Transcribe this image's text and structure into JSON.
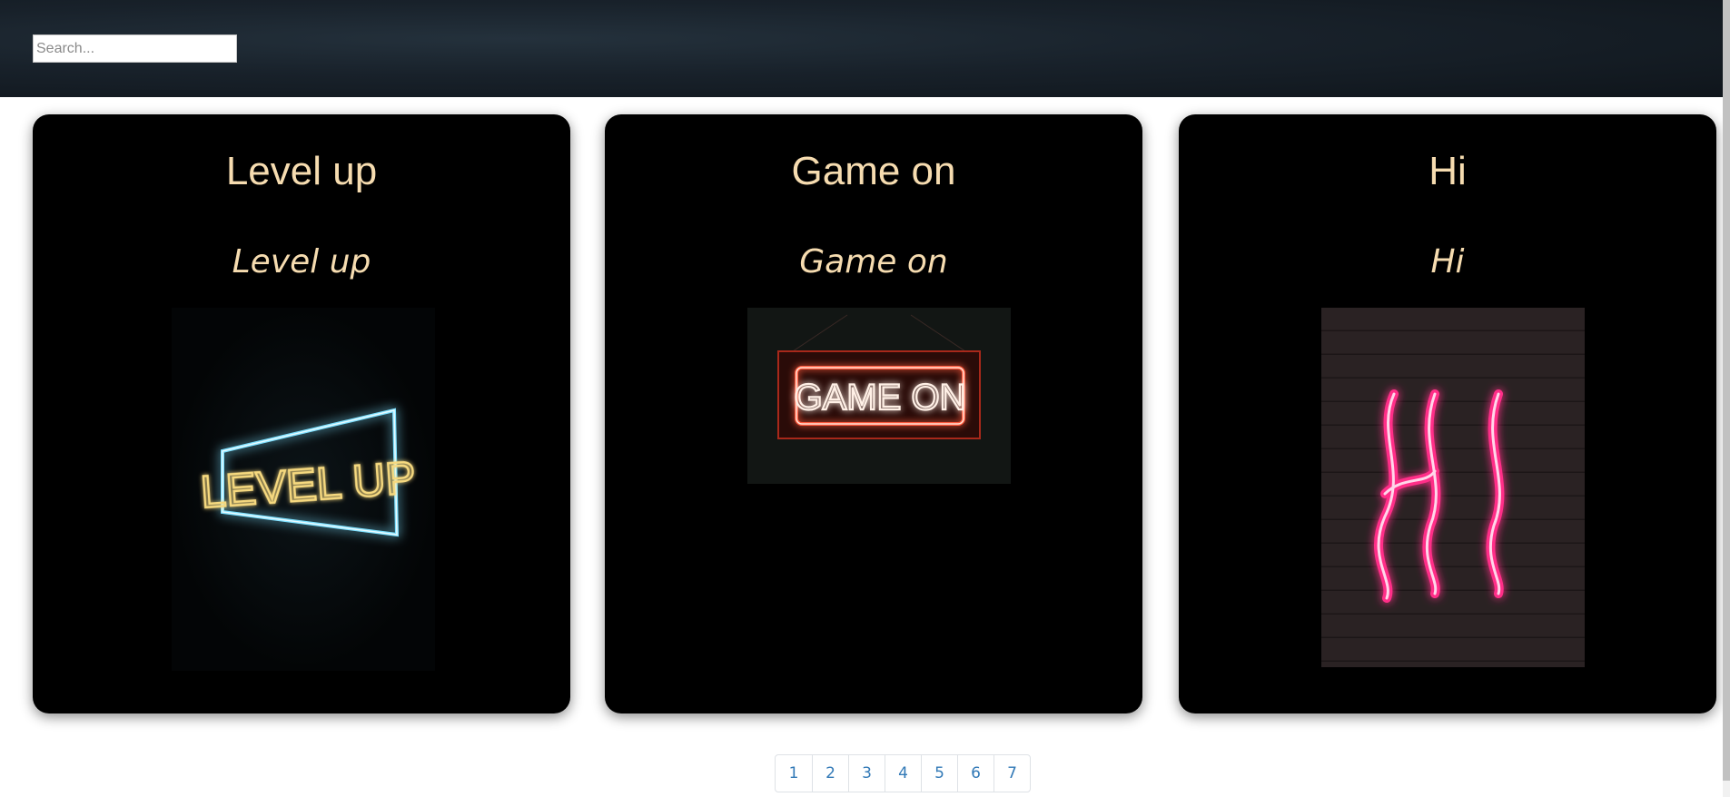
{
  "search": {
    "placeholder": "Search..."
  },
  "cards": [
    {
      "title": "Level up",
      "subtitle": "Level up",
      "image_icon": "level-up-neon-sign",
      "sign_text": "LEVEL UP",
      "neon_color": "#f3d27a"
    },
    {
      "title": "Game on",
      "subtitle": "Game on",
      "image_icon": "game-on-neon-sign",
      "sign_text": "GAME ON",
      "neon_color": "#ff5a3c"
    },
    {
      "title": "Hi",
      "subtitle": "Hi",
      "image_icon": "hi-neon-sign",
      "sign_text": "HI",
      "neon_color": "#ff2e88"
    }
  ],
  "pagination": {
    "pages": [
      "1",
      "2",
      "3",
      "4",
      "5",
      "6",
      "7"
    ]
  },
  "colors": {
    "card_text": "#f6dcb0",
    "card_background": "#000000",
    "link": "#337ab7"
  }
}
